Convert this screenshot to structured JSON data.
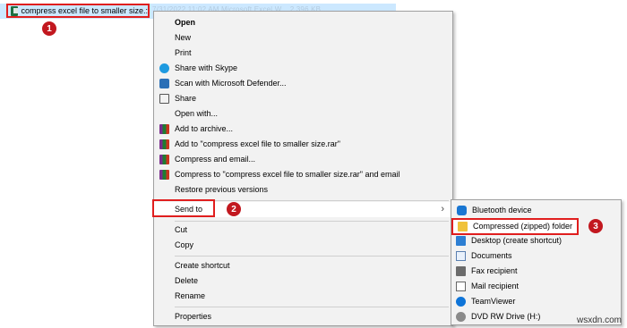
{
  "file": {
    "name": "compress excel file to smaller size.xlsx",
    "name_display": "compress excel file to smaller size.:",
    "details_faded": "7/31/2022 11:02 AM      Microsoft Excel W...      2,396 KB"
  },
  "badges": [
    "1",
    "2",
    "3"
  ],
  "context_menu": {
    "items": [
      {
        "label": "Open",
        "bold": true
      },
      {
        "label": "New"
      },
      {
        "label": "Print"
      },
      {
        "label": "Share with Skype",
        "icon": "skype-icon"
      },
      {
        "label": "Scan with Microsoft Defender...",
        "icon": "defender-icon"
      },
      {
        "label": "Share",
        "icon": "share-icon"
      },
      {
        "label": "Open with..."
      },
      {
        "label": "Add to archive...",
        "icon": "winrar-icon"
      },
      {
        "label": "Add to \"compress excel file to smaller size.rar\"",
        "icon": "winrar-icon"
      },
      {
        "label": "Compress and email...",
        "icon": "winrar-icon"
      },
      {
        "label": "Compress to \"compress excel file to smaller size.rar\" and email",
        "icon": "winrar-icon"
      },
      {
        "label": "Restore previous versions"
      },
      {
        "label": "Send to",
        "has_submenu": true
      },
      {
        "label": "Cut"
      },
      {
        "label": "Copy"
      },
      {
        "label": "Create shortcut"
      },
      {
        "label": "Delete"
      },
      {
        "label": "Rename"
      },
      {
        "label": "Properties"
      }
    ]
  },
  "send_to_menu": {
    "items": [
      {
        "label": "Bluetooth device",
        "icon": "bluetooth-icon"
      },
      {
        "label": "Compressed (zipped) folder",
        "icon": "zip-folder-icon"
      },
      {
        "label": "Desktop (create shortcut)",
        "icon": "desktop-icon"
      },
      {
        "label": "Documents",
        "icon": "documents-icon"
      },
      {
        "label": "Fax recipient",
        "icon": "fax-icon"
      },
      {
        "label": "Mail recipient",
        "icon": "mail-icon"
      },
      {
        "label": "TeamViewer",
        "icon": "teamviewer-icon"
      },
      {
        "label": "DVD RW Drive (H:)",
        "icon": "dvd-drive-icon"
      }
    ]
  },
  "watermark": "wsxdn.com",
  "colors": {
    "highlight_border": "#e01e1e",
    "badge": "#c2181f",
    "selection": "#cce8ff",
    "menu_bg": "#f2f2f2"
  }
}
